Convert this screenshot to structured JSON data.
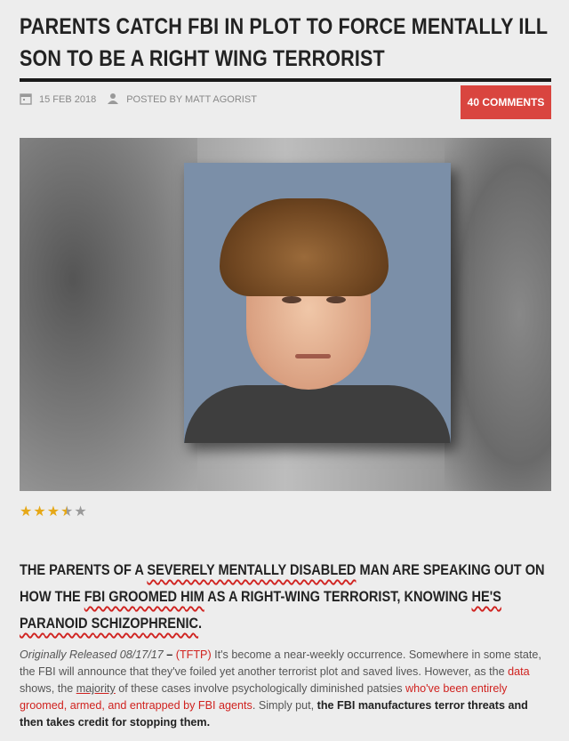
{
  "article": {
    "title": "PARENTS CATCH FBI IN PLOT TO FORCE MENTALLY ILL SON TO BE A RIGHT WING TERRORIST",
    "date": "15 FEB 2018",
    "author": "POSTED BY MATT AGORIST",
    "comments_label": "40 COMMENTS"
  },
  "rating": {
    "value": 3.5,
    "max": 5
  },
  "lead": {
    "p1": "THE PARENTS OF A ",
    "u1": "SEVERELY MENTALLY DISABLED",
    "p2": " MAN ARE SPEAKING OUT ON HOW THE ",
    "u2": "FBI GROOMED HIM",
    "p3": " AS A RIGHT-WING TERRORIST, KNOWING ",
    "u3": "HE'S PARANOID SCHIZOPHRENIC",
    "p4": "."
  },
  "body": {
    "released": "Originally Released 08/17/17",
    "dash": " – ",
    "paren_open": "(",
    "tftp": "TFTP",
    "paren_close": ")",
    "t1": " It's become a near-weekly occurrence. Somewhere in some state, the FBI will announce that they've foiled yet another terrorist plot and saved lives. However, as the ",
    "data_link": "data",
    "t2": " shows, the ",
    "majority": "majority",
    "t3": " of these cases involve psychologically diminished patsies ",
    "red_link": "who've been entirely groomed, armed, and entrapped by FBI agents",
    "t4": ". Simply put, ",
    "bold": "the FBI manufactures terror threats and then takes credit for stopping them."
  },
  "colors": {
    "accent": "#d9453f",
    "link": "#d0221f",
    "star": "#e6a817"
  },
  "icons": {
    "date": "calendar-icon",
    "author": "person-icon"
  }
}
